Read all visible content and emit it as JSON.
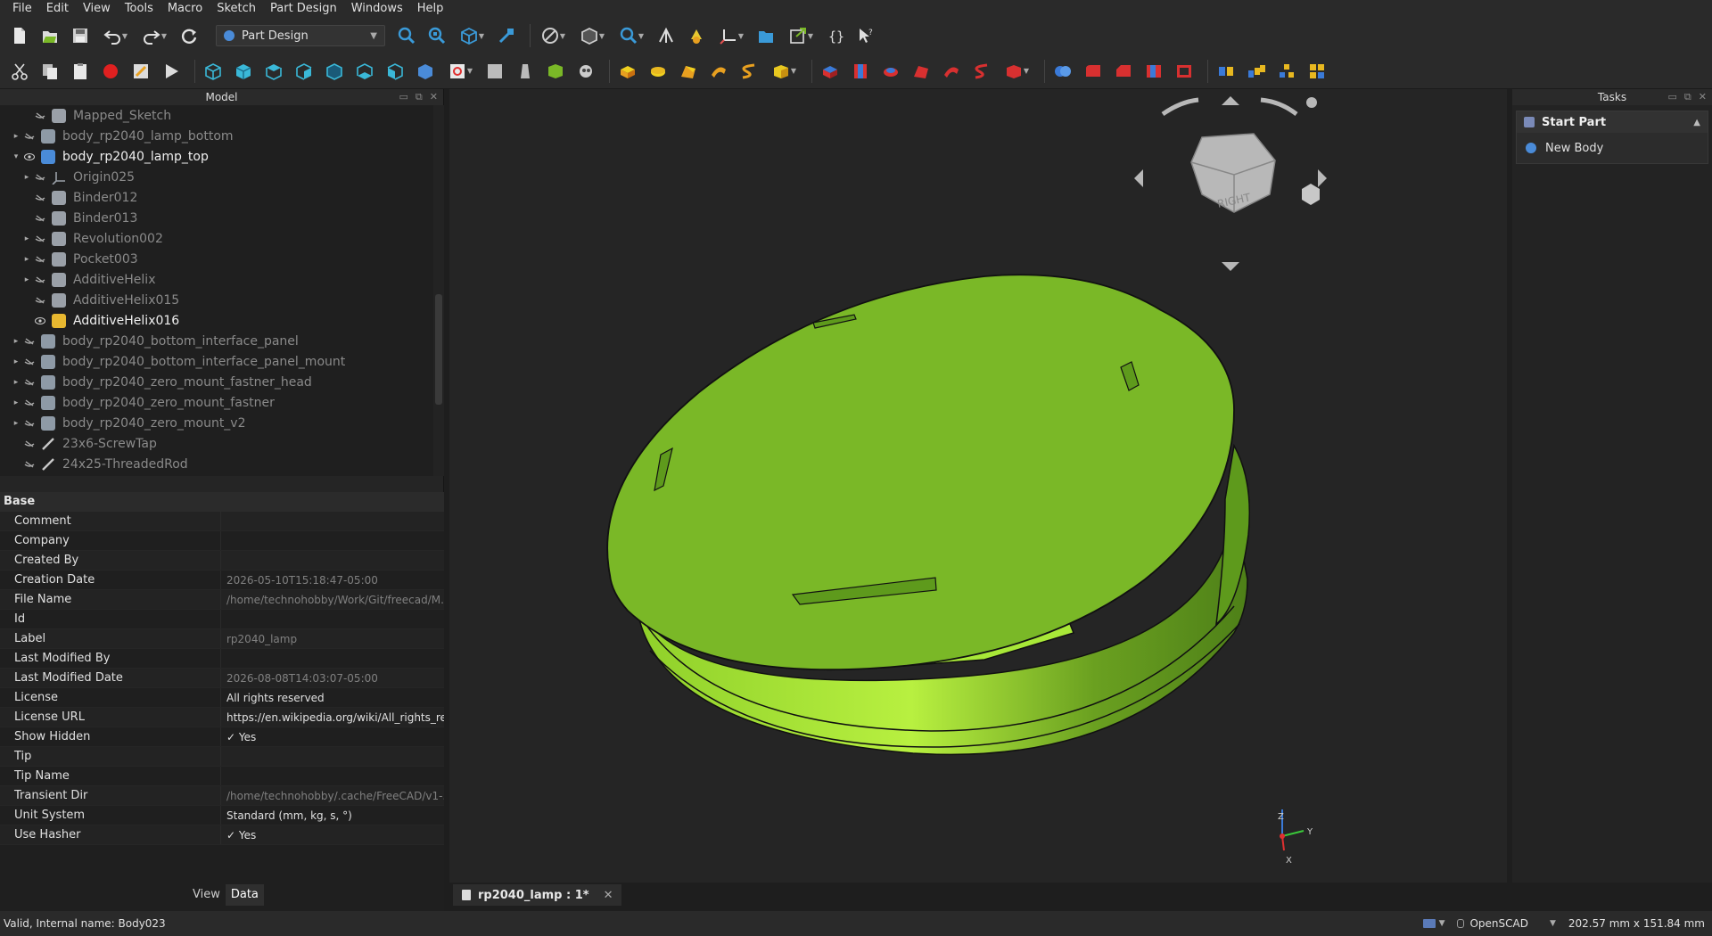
{
  "menu": [
    "File",
    "Edit",
    "View",
    "Tools",
    "Macro",
    "Sketch",
    "Part Design",
    "Windows",
    "Help"
  ],
  "workbench": {
    "selected": "Part Design"
  },
  "model_panel": {
    "title": "Model"
  },
  "tree": [
    {
      "label": "Mapped_Sketch",
      "indent": 1,
      "expander": "",
      "visible": false,
      "icon": "sketch-icon",
      "icon_color": "#9aa0a8",
      "state": "dim"
    },
    {
      "label": "body_rp2040_lamp_bottom",
      "indent": 0,
      "expander": "▸",
      "visible": false,
      "icon": "body-icon",
      "icon_color": "#8e9aa6",
      "state": "dim"
    },
    {
      "label": "body_rp2040_lamp_top",
      "indent": 0,
      "expander": "▾",
      "visible": true,
      "icon": "body-icon",
      "icon_color": "#4a8bd8",
      "state": "bright"
    },
    {
      "label": "Origin025",
      "indent": 1,
      "expander": "▸",
      "visible": false,
      "icon": "origin-icon",
      "icon_color": "#9aa0a8",
      "state": "dim"
    },
    {
      "label": "Binder012",
      "indent": 1,
      "expander": "",
      "visible": false,
      "icon": "binder-icon",
      "icon_color": "#9aa0a8",
      "state": "dim"
    },
    {
      "label": "Binder013",
      "indent": 1,
      "expander": "",
      "visible": false,
      "icon": "binder-icon",
      "icon_color": "#9aa0a8",
      "state": "dim"
    },
    {
      "label": "Revolution002",
      "indent": 1,
      "expander": "▸",
      "visible": false,
      "icon": "revolution-icon",
      "icon_color": "#9aa0a8",
      "state": "dim"
    },
    {
      "label": "Pocket003",
      "indent": 1,
      "expander": "▸",
      "visible": false,
      "icon": "pocket-icon",
      "icon_color": "#9aa0a8",
      "state": "dim"
    },
    {
      "label": "AdditiveHelix",
      "indent": 1,
      "expander": "▸",
      "visible": false,
      "icon": "helix-icon",
      "icon_color": "#9aa0a8",
      "state": "dim"
    },
    {
      "label": "AdditiveHelix015",
      "indent": 1,
      "expander": "",
      "visible": false,
      "icon": "helix-icon",
      "icon_color": "#9aa0a8",
      "state": "dim"
    },
    {
      "label": "AdditiveHelix016",
      "indent": 1,
      "expander": "",
      "visible": true,
      "icon": "helix-icon",
      "icon_color": "#e8b830",
      "state": "bright"
    },
    {
      "label": "body_rp2040_bottom_interface_panel",
      "indent": 0,
      "expander": "▸",
      "visible": false,
      "icon": "body-icon",
      "icon_color": "#8e9aa6",
      "state": "dim"
    },
    {
      "label": "body_rp2040_bottom_interface_panel_mount",
      "indent": 0,
      "expander": "▸",
      "visible": false,
      "icon": "body-icon",
      "icon_color": "#8e9aa6",
      "state": "dim"
    },
    {
      "label": "body_rp2040_zero_mount_fastner_head",
      "indent": 0,
      "expander": "▸",
      "visible": false,
      "icon": "body-icon",
      "icon_color": "#8e9aa6",
      "state": "dim"
    },
    {
      "label": "body_rp2040_zero_mount_fastner",
      "indent": 0,
      "expander": "▸",
      "visible": false,
      "icon": "body-icon",
      "icon_color": "#8e9aa6",
      "state": "dim"
    },
    {
      "label": "body_rp2040_zero_mount_v2",
      "indent": 0,
      "expander": "▸",
      "visible": false,
      "icon": "body-icon",
      "icon_color": "#8e9aa6",
      "state": "dim"
    },
    {
      "label": "23x6-ScrewTap",
      "indent": 0,
      "expander": "",
      "visible": false,
      "icon": "wire-icon",
      "icon_color": "#c8c8c8",
      "state": "dim"
    },
    {
      "label": "24x25-ThreadedRod",
      "indent": 0,
      "expander": "",
      "visible": false,
      "icon": "wire-icon",
      "icon_color": "#c8c8c8",
      "state": "dim"
    }
  ],
  "properties": {
    "group": "Base",
    "rows": [
      {
        "key": "Comment",
        "value": "",
        "dim": false
      },
      {
        "key": "Company",
        "value": "",
        "dim": false
      },
      {
        "key": "Created By",
        "value": "",
        "dim": false
      },
      {
        "key": "Creation Date",
        "value": "2026-05-10T15:18:47-05:00",
        "dim": true
      },
      {
        "key": "File Name",
        "value": "/home/technohobby/Work/Git/freecad/M...",
        "dim": true
      },
      {
        "key": "Id",
        "value": "",
        "dim": false
      },
      {
        "key": "Label",
        "value": "rp2040_lamp",
        "dim": true
      },
      {
        "key": "Last Modified By",
        "value": "",
        "dim": false
      },
      {
        "key": "Last Modified Date",
        "value": "2026-08-08T14:03:07-05:00",
        "dim": true
      },
      {
        "key": "License",
        "value": "All rights reserved",
        "dim": false
      },
      {
        "key": "License URL",
        "value": "https://en.wikipedia.org/wiki/All_rights_re...",
        "dim": false
      },
      {
        "key": "Show Hidden",
        "value": "✓  Yes",
        "dim": false
      },
      {
        "key": "Tip",
        "value": "",
        "dim": false
      },
      {
        "key": "Tip Name",
        "value": "",
        "dim": false
      },
      {
        "key": "Transient Dir",
        "value": "/home/technohobby/.cache/FreeCAD/v1-...",
        "dim": true
      },
      {
        "key": "Unit System",
        "value": "Standard (mm, kg, s, °)",
        "dim": false
      },
      {
        "key": "Use Hasher",
        "value": "✓  Yes",
        "dim": false
      }
    ]
  },
  "panel_tabs": {
    "view": "View",
    "data": "Data"
  },
  "view3d": {
    "nav_cube_face": "RIGHT",
    "axis": {
      "x": "X",
      "y": "Y",
      "z": "Z"
    },
    "model_color": "#7ab827"
  },
  "document_tab": {
    "label": "rp2040_lamp : 1*",
    "close": "✕"
  },
  "tasks": {
    "title": "Tasks",
    "box_title": "Start Part",
    "item": "New Body"
  },
  "status": {
    "message": "Valid, Internal name: Body023",
    "navigation": "OpenSCAD",
    "dimensions": "202.57 mm x 151.84 mm"
  },
  "colors": {
    "accent": "#4a8bd8",
    "model_green": "#7ab827",
    "background": "#1e1e1e"
  }
}
